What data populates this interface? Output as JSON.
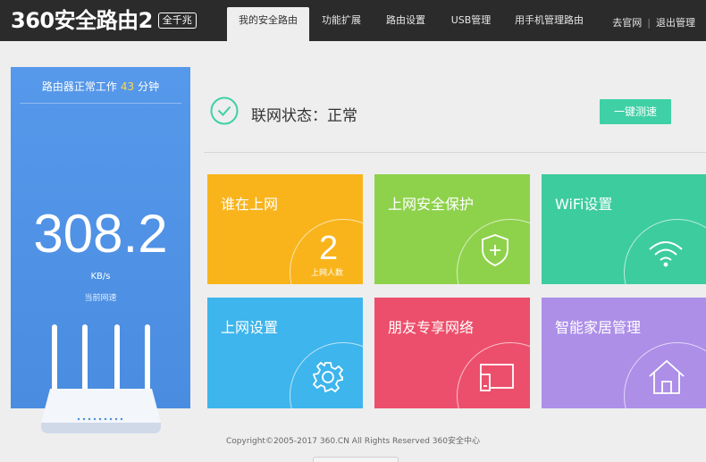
{
  "header": {
    "logo_text": "360安全路由2",
    "logo_badge": "全千兆",
    "nav": [
      {
        "label": "我的安全路由",
        "active": true
      },
      {
        "label": "功能扩展",
        "active": false
      },
      {
        "label": "路由设置",
        "active": false
      },
      {
        "label": "USB管理",
        "active": false
      },
      {
        "label": "用手机管理路由",
        "active": false
      }
    ],
    "links": {
      "official": "去官网",
      "logout": "退出管理"
    }
  },
  "left_panel": {
    "work_prefix": "路由器正常工作",
    "work_minutes": "43",
    "work_suffix": "分钟",
    "speed_value": "308.2",
    "speed_unit": "KB/s",
    "speed_label": "当前网速",
    "colors": {
      "bg": "#4a8fe0",
      "minutes": "#ffd84a"
    }
  },
  "status": {
    "text": "联网状态：正常",
    "test_button": "一键测速",
    "colors": {
      "ok": "#3fd0a6"
    }
  },
  "tiles": [
    {
      "title": "谁在上网",
      "count": "2",
      "count_label": "上网人数",
      "color": "#f9b41c",
      "icon": "online-count"
    },
    {
      "title": "上网安全保护",
      "color": "#8ed24c",
      "icon": "shield-icon"
    },
    {
      "title": "WiFi设置",
      "color": "#3dcc9e",
      "icon": "wifi-icon"
    },
    {
      "title": "上网设置",
      "color": "#3eb5ec",
      "icon": "gear-icon"
    },
    {
      "title": "朋友专享网络",
      "color": "#ec4f6b",
      "icon": "devices-icon"
    },
    {
      "title": "智能家居管理",
      "color": "#ad8fe8",
      "icon": "home-icon"
    }
  ],
  "footer": {
    "copyright": "Copyright©2005-2017 360.CN All Rights Reserved 360安全中心"
  }
}
